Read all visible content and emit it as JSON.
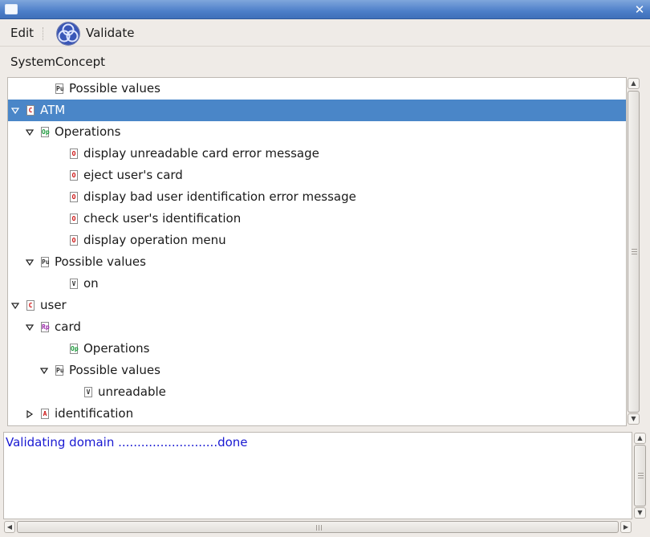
{
  "menubar": {
    "edit": "Edit",
    "validate": "Validate"
  },
  "breadcrumb": "SystemConcept",
  "tree": [
    {
      "label": "Possible values",
      "icon": "Pu",
      "icon_name": "possible-values-icon",
      "icon_color": "#333333",
      "depth": 2,
      "toggle": "none"
    },
    {
      "label": "ATM",
      "icon": "C",
      "icon_name": "concept-icon",
      "icon_color": "#cc1111",
      "depth": 0,
      "toggle": "expanded",
      "selected": true
    },
    {
      "label": "Operations",
      "icon": "Op",
      "icon_name": "operations-icon",
      "icon_color": "#1a9a3a",
      "depth": 1,
      "toggle": "expanded"
    },
    {
      "label": "display unreadable card error message",
      "icon": "O",
      "icon_name": "operation-icon",
      "icon_color": "#cc1111",
      "depth": 3,
      "toggle": "none"
    },
    {
      "label": "eject user's card",
      "icon": "O",
      "icon_name": "operation-icon",
      "icon_color": "#cc1111",
      "depth": 3,
      "toggle": "none"
    },
    {
      "label": "display bad user identification error message",
      "icon": "O",
      "icon_name": "operation-icon",
      "icon_color": "#cc1111",
      "depth": 3,
      "toggle": "none"
    },
    {
      "label": "check user's identification",
      "icon": "O",
      "icon_name": "operation-icon",
      "icon_color": "#cc1111",
      "depth": 3,
      "toggle": "none"
    },
    {
      "label": "display operation menu",
      "icon": "O",
      "icon_name": "operation-icon",
      "icon_color": "#cc1111",
      "depth": 3,
      "toggle": "none"
    },
    {
      "label": "Possible values",
      "icon": "Pu",
      "icon_name": "possible-values-icon",
      "icon_color": "#333333",
      "depth": 1,
      "toggle": "expanded"
    },
    {
      "label": "on",
      "icon": "V",
      "icon_name": "value-icon",
      "icon_color": "#333333",
      "depth": 3,
      "toggle": "none"
    },
    {
      "label": "user",
      "icon": "C",
      "icon_name": "concept-icon",
      "icon_color": "#cc1111",
      "depth": 0,
      "toggle": "expanded"
    },
    {
      "label": "card",
      "icon": "Rp",
      "icon_name": "relation-icon",
      "icon_color": "#9a2aa8",
      "depth": 1,
      "toggle": "expanded"
    },
    {
      "label": "Operations",
      "icon": "Op",
      "icon_name": "operations-icon",
      "icon_color": "#1a9a3a",
      "depth": 3,
      "toggle": "none"
    },
    {
      "label": "Possible values",
      "icon": "Pu",
      "icon_name": "possible-values-icon",
      "icon_color": "#333333",
      "depth": 2,
      "toggle": "expanded"
    },
    {
      "label": "unreadable",
      "icon": "V",
      "icon_name": "value-icon",
      "icon_color": "#333333",
      "depth": 4,
      "toggle": "none"
    },
    {
      "label": "identification",
      "icon": "A",
      "icon_name": "attribute-icon",
      "icon_color": "#cc1111",
      "depth": 1,
      "toggle": "collapsed"
    }
  ],
  "log": {
    "text": "Validating domain ..........................done"
  }
}
